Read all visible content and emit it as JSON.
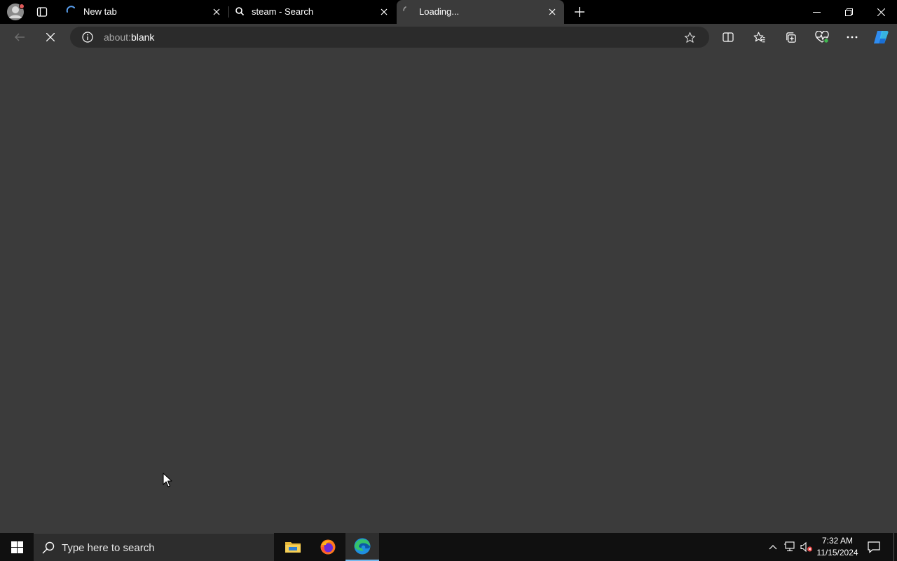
{
  "browser": {
    "tabs": [
      {
        "title": "New tab",
        "favicon": "loading-spinner-icon",
        "active": false
      },
      {
        "title": "steam - Search",
        "favicon": "search-icon",
        "active": false
      },
      {
        "title": "Loading...",
        "favicon": "loading-spinner-icon",
        "active": true
      }
    ],
    "address_bar": {
      "scheme": "about:",
      "rest": "blank"
    },
    "toolbar_icons": [
      "back-icon",
      "stop-icon",
      "info-icon",
      "favorite-star-icon",
      "split-screen-icon",
      "favorites-icon",
      "collections-icon",
      "browser-essentials-icon",
      "more-icon",
      "copilot-icon"
    ]
  },
  "taskbar": {
    "search_placeholder": "Type here to search",
    "pinned_apps": [
      "file-explorer",
      "firefox",
      "edge"
    ],
    "clock": {
      "time": "7:32 AM",
      "date": "11/15/2024"
    }
  },
  "colors": {
    "tabstrip": "#000000",
    "page": "#3b3b3b",
    "omnibox": "#2b2b2b",
    "taskbar": "#101010",
    "accent": "#76b9ed"
  }
}
